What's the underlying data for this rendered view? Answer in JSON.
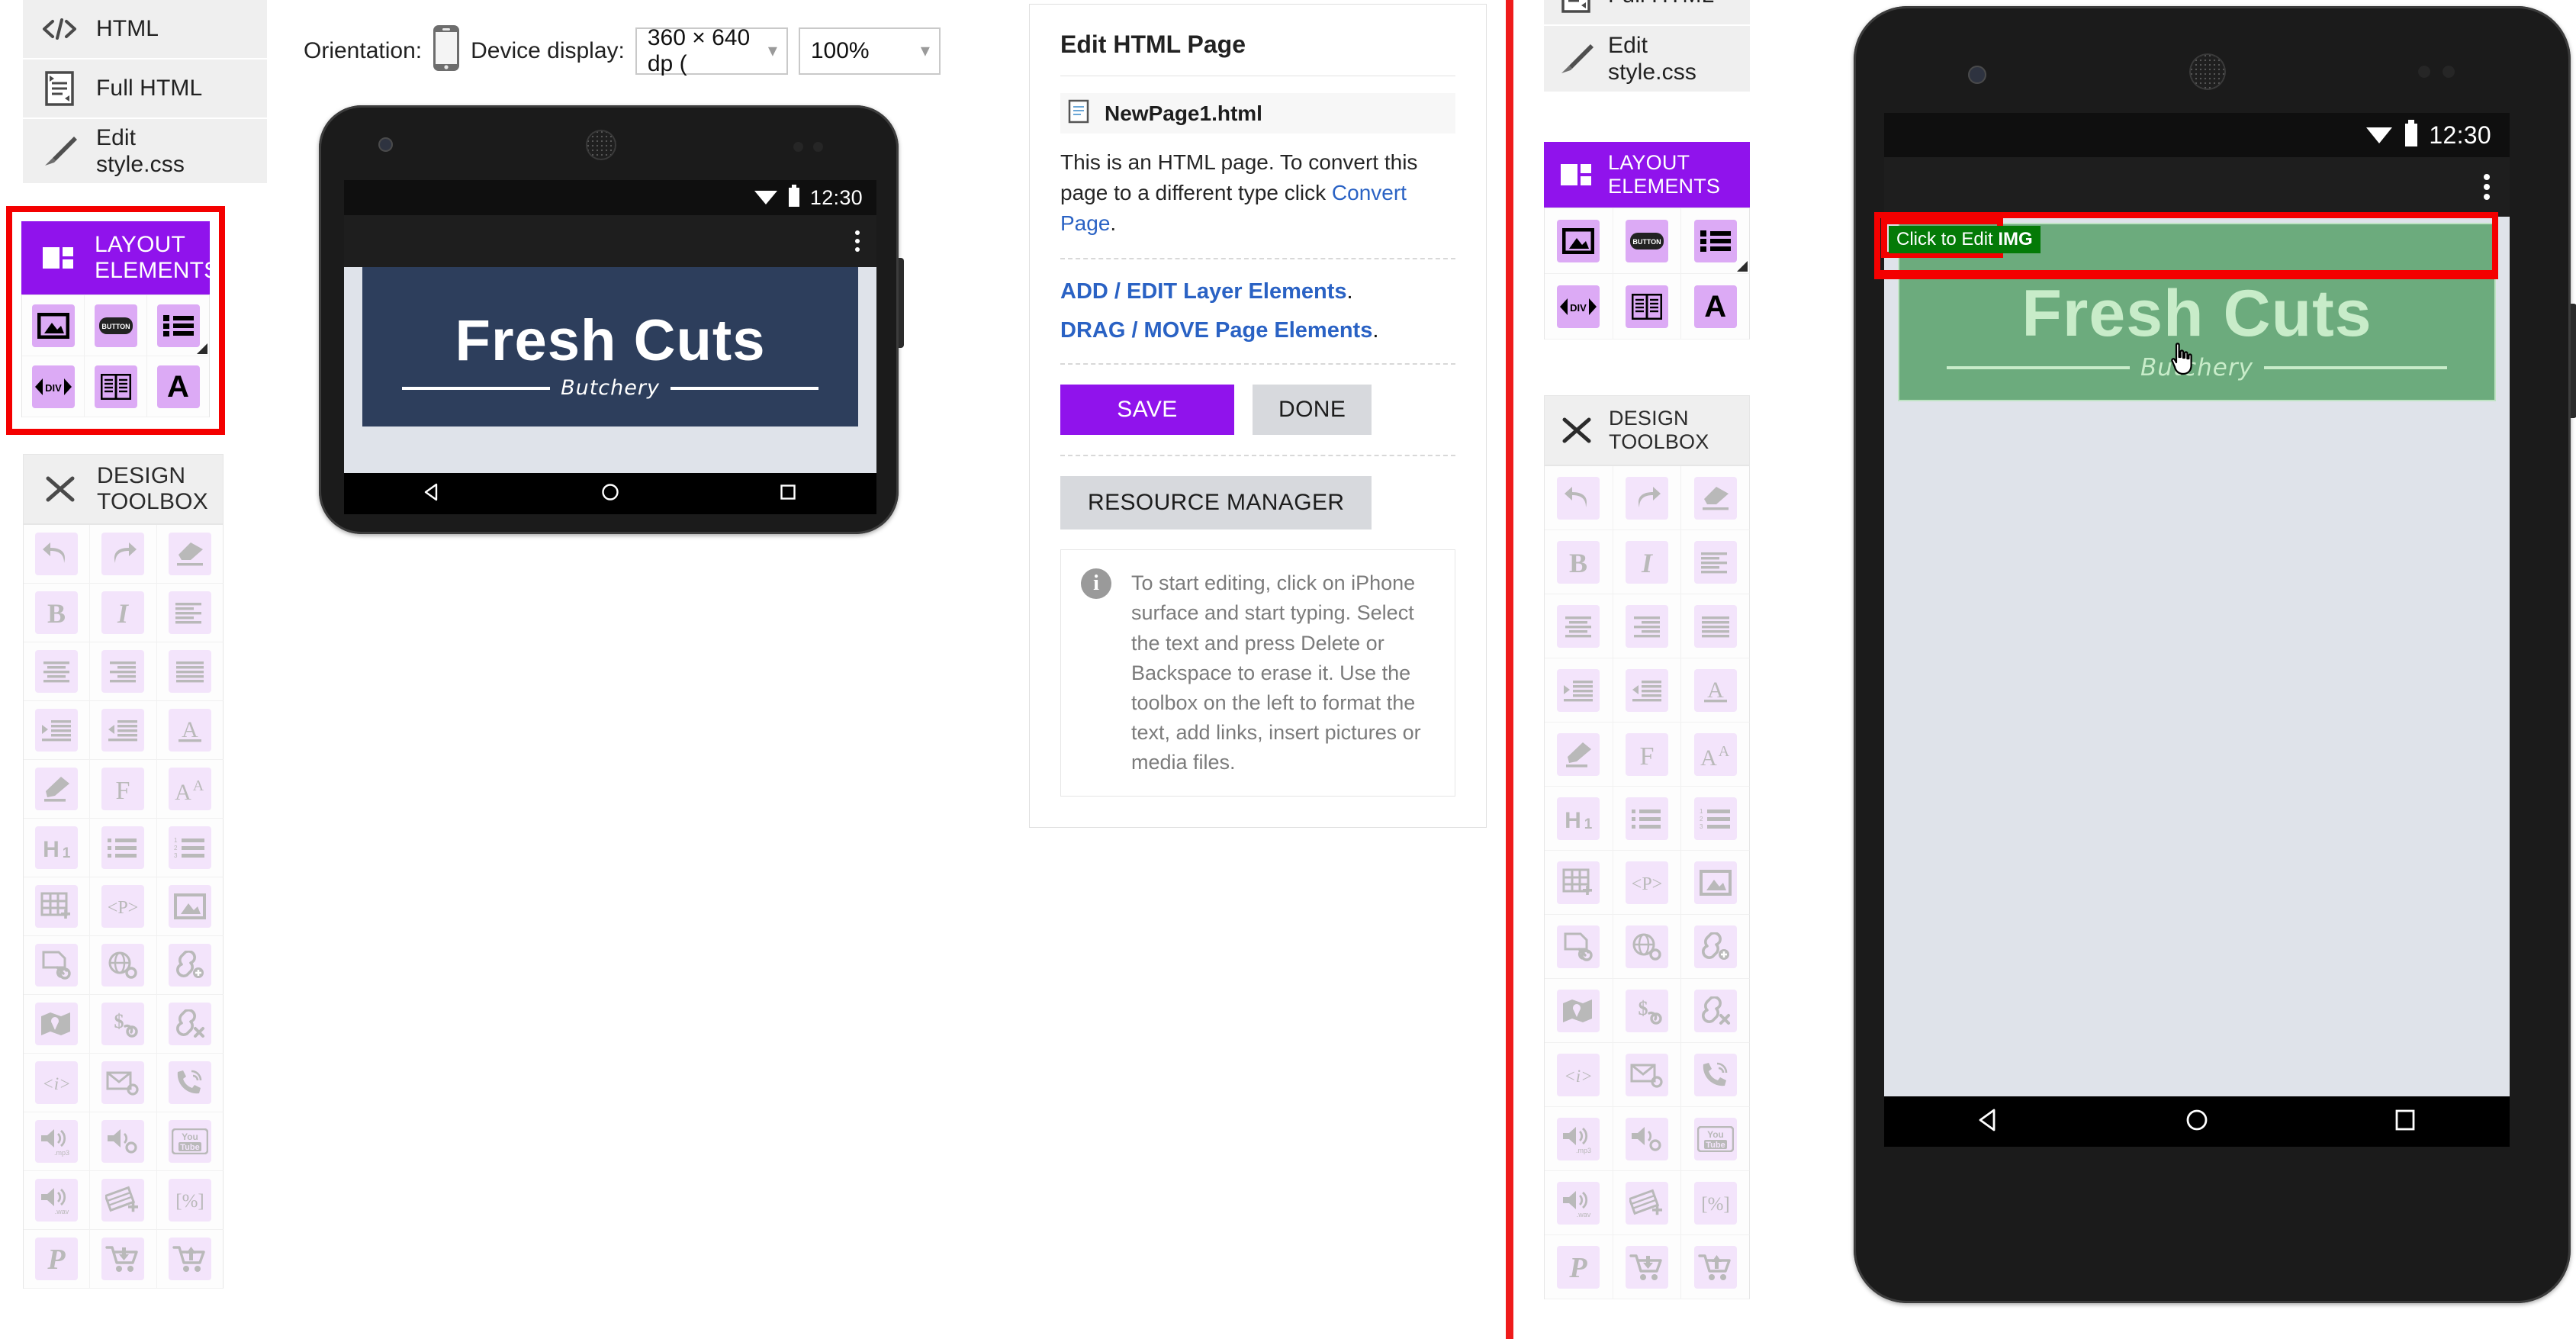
{
  "nav_items": [
    {
      "label": "HTML",
      "icon": "code-icon"
    },
    {
      "label": "Full HTML",
      "icon": "document-icon"
    },
    {
      "label": "Edit\nstyle.css",
      "icon": "paintbrush-icon"
    }
  ],
  "nav_items_right": [
    {
      "label": "Full HTML",
      "icon": "document-icon"
    },
    {
      "label": "Edit\nstyle.css",
      "icon": "paintbrush-icon"
    }
  ],
  "layout_panel": {
    "title": "LAYOUT ELEMENTS",
    "title_line1": "LAYOUT",
    "title_line2": "ELEMENTS",
    "icon": "layout-grid-icon",
    "accent_color": "#9013ec",
    "tiles": [
      {
        "name": "insert-image-icon",
        "glyph": "🖼"
      },
      {
        "name": "insert-button-icon",
        "glyph": "BUTTON"
      },
      {
        "name": "insert-list-icon",
        "glyph": "☰"
      },
      {
        "name": "insert-div-icon",
        "glyph": "‹DIV›"
      },
      {
        "name": "insert-article-icon",
        "glyph": "📰"
      },
      {
        "name": "insert-text-icon",
        "glyph": "A"
      }
    ]
  },
  "design_panel": {
    "title": "DESIGN TOOLBOX",
    "title_line1": "DESIGN",
    "title_line2": "TOOLBOX",
    "icon": "pencil-ruler-icon",
    "tiles": [
      {
        "name": "undo-icon",
        "glyph": "↶"
      },
      {
        "name": "redo-icon",
        "glyph": "↷"
      },
      {
        "name": "clear-format-icon",
        "glyph": "✐"
      },
      {
        "name": "bold-icon",
        "glyph": "B"
      },
      {
        "name": "italic-icon",
        "glyph": "I"
      },
      {
        "name": "align-left-icon",
        "glyph": "☰"
      },
      {
        "name": "align-center-icon",
        "glyph": "☰"
      },
      {
        "name": "align-right-icon",
        "glyph": "☰"
      },
      {
        "name": "align-justify-icon",
        "glyph": "☰"
      },
      {
        "name": "indent-increase-icon",
        "glyph": "⇥"
      },
      {
        "name": "indent-decrease-icon",
        "glyph": "⇤"
      },
      {
        "name": "underline-icon",
        "glyph": "A"
      },
      {
        "name": "highlighter-icon",
        "glyph": "✎"
      },
      {
        "name": "font-family-icon",
        "glyph": "F"
      },
      {
        "name": "font-size-icon",
        "glyph": "A"
      },
      {
        "name": "heading-h1-icon",
        "glyph": "H1"
      },
      {
        "name": "bullet-list-icon",
        "glyph": "☰"
      },
      {
        "name": "numbered-list-icon",
        "glyph": "☰"
      },
      {
        "name": "insert-table-icon",
        "glyph": "⊞"
      },
      {
        "name": "paragraph-tag-icon",
        "glyph": "<P>"
      },
      {
        "name": "insert-picture-icon",
        "glyph": "🖼"
      },
      {
        "name": "file-link-icon",
        "glyph": "📄"
      },
      {
        "name": "web-link-icon",
        "glyph": "🌐"
      },
      {
        "name": "add-link-icon",
        "glyph": "🔗"
      },
      {
        "name": "map-link-icon",
        "glyph": "🗺"
      },
      {
        "name": "payment-link-icon",
        "glyph": "$"
      },
      {
        "name": "remove-link-icon",
        "glyph": "🔗"
      },
      {
        "name": "italic-tag-icon",
        "glyph": "<i>"
      },
      {
        "name": "email-link-icon",
        "glyph": "✉"
      },
      {
        "name": "phone-link-icon",
        "glyph": "☎"
      },
      {
        "name": "audio-mp3-icon",
        "glyph": "🔊",
        "sub": ".mp3"
      },
      {
        "name": "audio-link-icon",
        "glyph": "🔊"
      },
      {
        "name": "youtube-icon",
        "glyph": "You\nTube"
      },
      {
        "name": "audio-wav-icon",
        "glyph": "🔊",
        "sub": ".wav"
      },
      {
        "name": "add-film-icon",
        "glyph": "🎞"
      },
      {
        "name": "percent-icon",
        "glyph": "[%]"
      },
      {
        "name": "paypal-icon",
        "glyph": "P"
      },
      {
        "name": "cart-add-icon",
        "glyph": "🛒"
      },
      {
        "name": "cart-upload-icon",
        "glyph": "🛒"
      }
    ]
  },
  "toolbar": {
    "orientation_label": "Orientation:",
    "orientation_icon": "phone-portrait-icon",
    "device_label": "Device display:",
    "device_value": "360 × 640 dp (",
    "zoom_value": "100%"
  },
  "phone_left": {
    "status_time": "12:30",
    "wifi_icon": "wifi-icon",
    "battery_icon": "battery-icon",
    "overflow_icon": "kebab-menu-icon",
    "banner": {
      "title": "Fresh Cuts",
      "subtitle": "Butchery",
      "bg_color": "#2d3e5c",
      "text_color": "#ffffff"
    },
    "nav": {
      "back_icon": "back-triangle-icon",
      "home_icon": "home-circle-icon",
      "recents_icon": "recents-square-icon"
    }
  },
  "phone_right": {
    "status_time": "12:30",
    "wifi_icon": "wifi-icon",
    "battery_icon": "battery-icon",
    "overflow_icon": "kebab-menu-icon",
    "tooltip_text_prefix": "Click to Edit ",
    "tooltip_text_bold": "IMG",
    "tooltip_bg": "#047a07",
    "selection_color": "#f40000",
    "cursor_icon": "pointing-hand-cursor",
    "banner": {
      "title": "Fresh Cuts",
      "subtitle": "Butchery",
      "bg_color": "#6cab7d",
      "text_color": "#c8ecc9"
    },
    "nav": {
      "back_icon": "back-triangle-icon",
      "home_icon": "home-circle-icon",
      "recents_icon": "recents-square-icon"
    }
  },
  "edit_card": {
    "title": "Edit HTML Page",
    "file_icon": "page-file-icon",
    "file_name": "NewPage1.html",
    "blurb_prefix": "This is an HTML page. To convert this page to a different type click ",
    "blurb_link": "Convert Page",
    "blurb_suffix": ".",
    "link_add_edit": "ADD / EDIT Layer Elements",
    "link_drag_move": "DRAG / MOVE Page Elements",
    "save_label": "SAVE",
    "done_label": "DONE",
    "resource_manager_label": "RESOURCE MANAGER",
    "info_icon": "info-icon",
    "info_text": "To start editing, click on iPhone surface and start typing. Select the text and press Delete or Backspace to erase it. Use the toolbox on the left to format the text, add links, insert pictures or media files."
  }
}
